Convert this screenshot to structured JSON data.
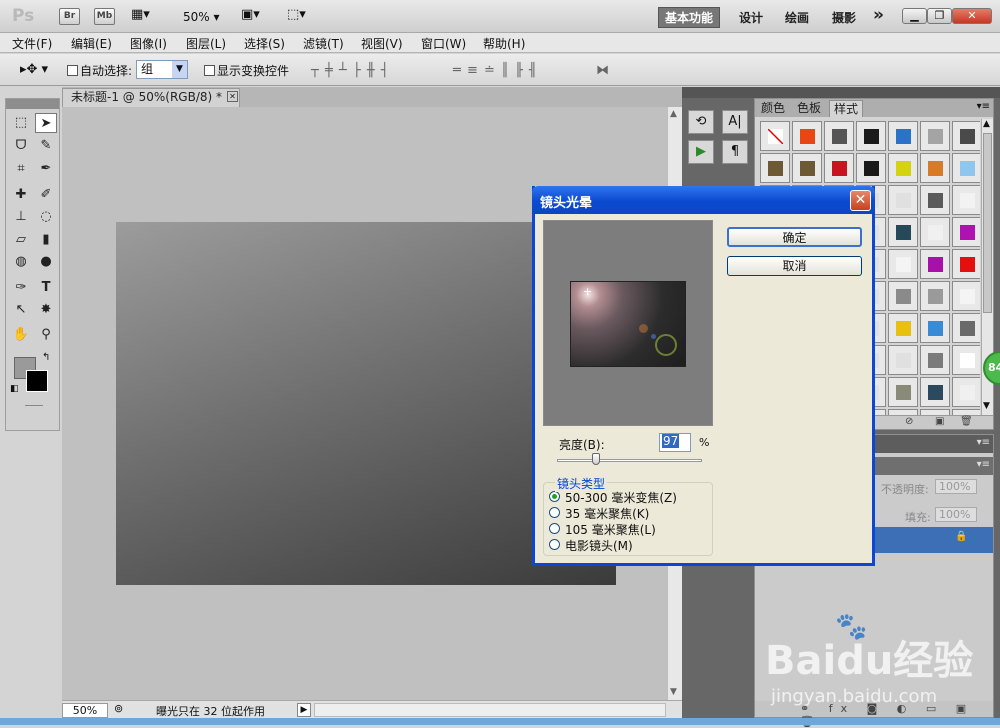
{
  "app": {
    "logo": "Ps",
    "bridge": "Br",
    "mini_bridge": "Mb",
    "zoom": "50%",
    "workspaces": [
      "基本功能",
      "设计",
      "绘画",
      "摄影"
    ],
    "more": "»"
  },
  "menu": [
    "文件(F)",
    "编辑(E)",
    "图像(I)",
    "图层(L)",
    "选择(S)",
    "滤镜(T)",
    "视图(V)",
    "窗口(W)",
    "帮助(H)"
  ],
  "options": {
    "auto_select_label": "自动选择:",
    "auto_select_value": "组",
    "show_transform_label": "显示变换控件"
  },
  "document": {
    "tab_title": "未标题-1 @ 50%(RGB/8) *",
    "zoom": "50%",
    "status": "曝光只在 32 位起作用"
  },
  "styles_panel": {
    "tabs": [
      "颜色",
      "色板",
      "样式"
    ],
    "swatch_colors": [
      "#ffffff",
      "#e84612",
      "#555555",
      "#1b1b1b",
      "#2a73c9",
      "#a4a4a4",
      "#4a4a4a",
      "#6e5a32",
      "#6e5a32",
      "#c8141e",
      "#1a1a1a",
      "#d4d40e",
      "#d97a24",
      "#8fc6ee",
      "#cfcfcf",
      "#e0e0e0",
      "#e0e0e0",
      "#e0e0e0",
      "#e0e0e0",
      "#5a5a5a",
      "#f2f2f2",
      "#e0e0e0",
      "#e0e0e0",
      "#e0e0e0",
      "#e0e0e0",
      "#244958",
      "#f0f0f0",
      "#b012b0",
      "#e0e0e0",
      "#e0e0e0",
      "#e0e0e0",
      "#e0e0e0",
      "#f4f4f4",
      "#a810a8",
      "#e41010",
      "#e0e0e0",
      "#e0e0e0",
      "#e0e0e0",
      "#e0e0e0",
      "#8a8a8a",
      "#9a9a9a",
      "#f4f4f4",
      "#e0e0e0",
      "#e0e0e0",
      "#e0e0e0",
      "#e0e0e0",
      "#e8c010",
      "#3a8bd6",
      "#6a6a6a",
      "#e0e0e0",
      "#e0e0e0",
      "#e0e0e0",
      "#e0e0e0",
      "#e0e0e0",
      "#7a7a7a",
      "#ffffff",
      "#e0e0e0",
      "#e0e0e0",
      "#e0e0e0",
      "#e0e0e0",
      "#8a8a78",
      "#2b4a5e",
      "#f0f0f0",
      "#e0e0e0",
      "#e0e0e0",
      "#e0e0e0",
      "#e0e0e0",
      "#3a6fd0",
      "#e0e0e0",
      "#a010a0"
    ]
  },
  "layers_panel": {
    "opacity_label": "不透明度:",
    "opacity_value": "100%",
    "fill_label": "填充:",
    "fill_value": "100%",
    "footer_icons": "⚭ fx ◙ ◐ ▭ ▣ 🗑"
  },
  "dialog": {
    "title": "镜头光晕",
    "ok": "确定",
    "cancel": "取消",
    "brightness_label": "亮度(B):",
    "brightness_value": "97",
    "percent": "%",
    "lens_group_label": "镜头类型",
    "lens_types": [
      "50-300 毫米变焦(Z)",
      "35 毫米聚焦(K)",
      "105 毫米聚焦(L)",
      "电影镜头(M)"
    ],
    "selected_lens": 0,
    "brightness_fraction": 0.27
  },
  "overlay": {
    "badge": "84",
    "watermark": "Baidu经验",
    "watermark_sub": "jingyan.baidu.com"
  }
}
